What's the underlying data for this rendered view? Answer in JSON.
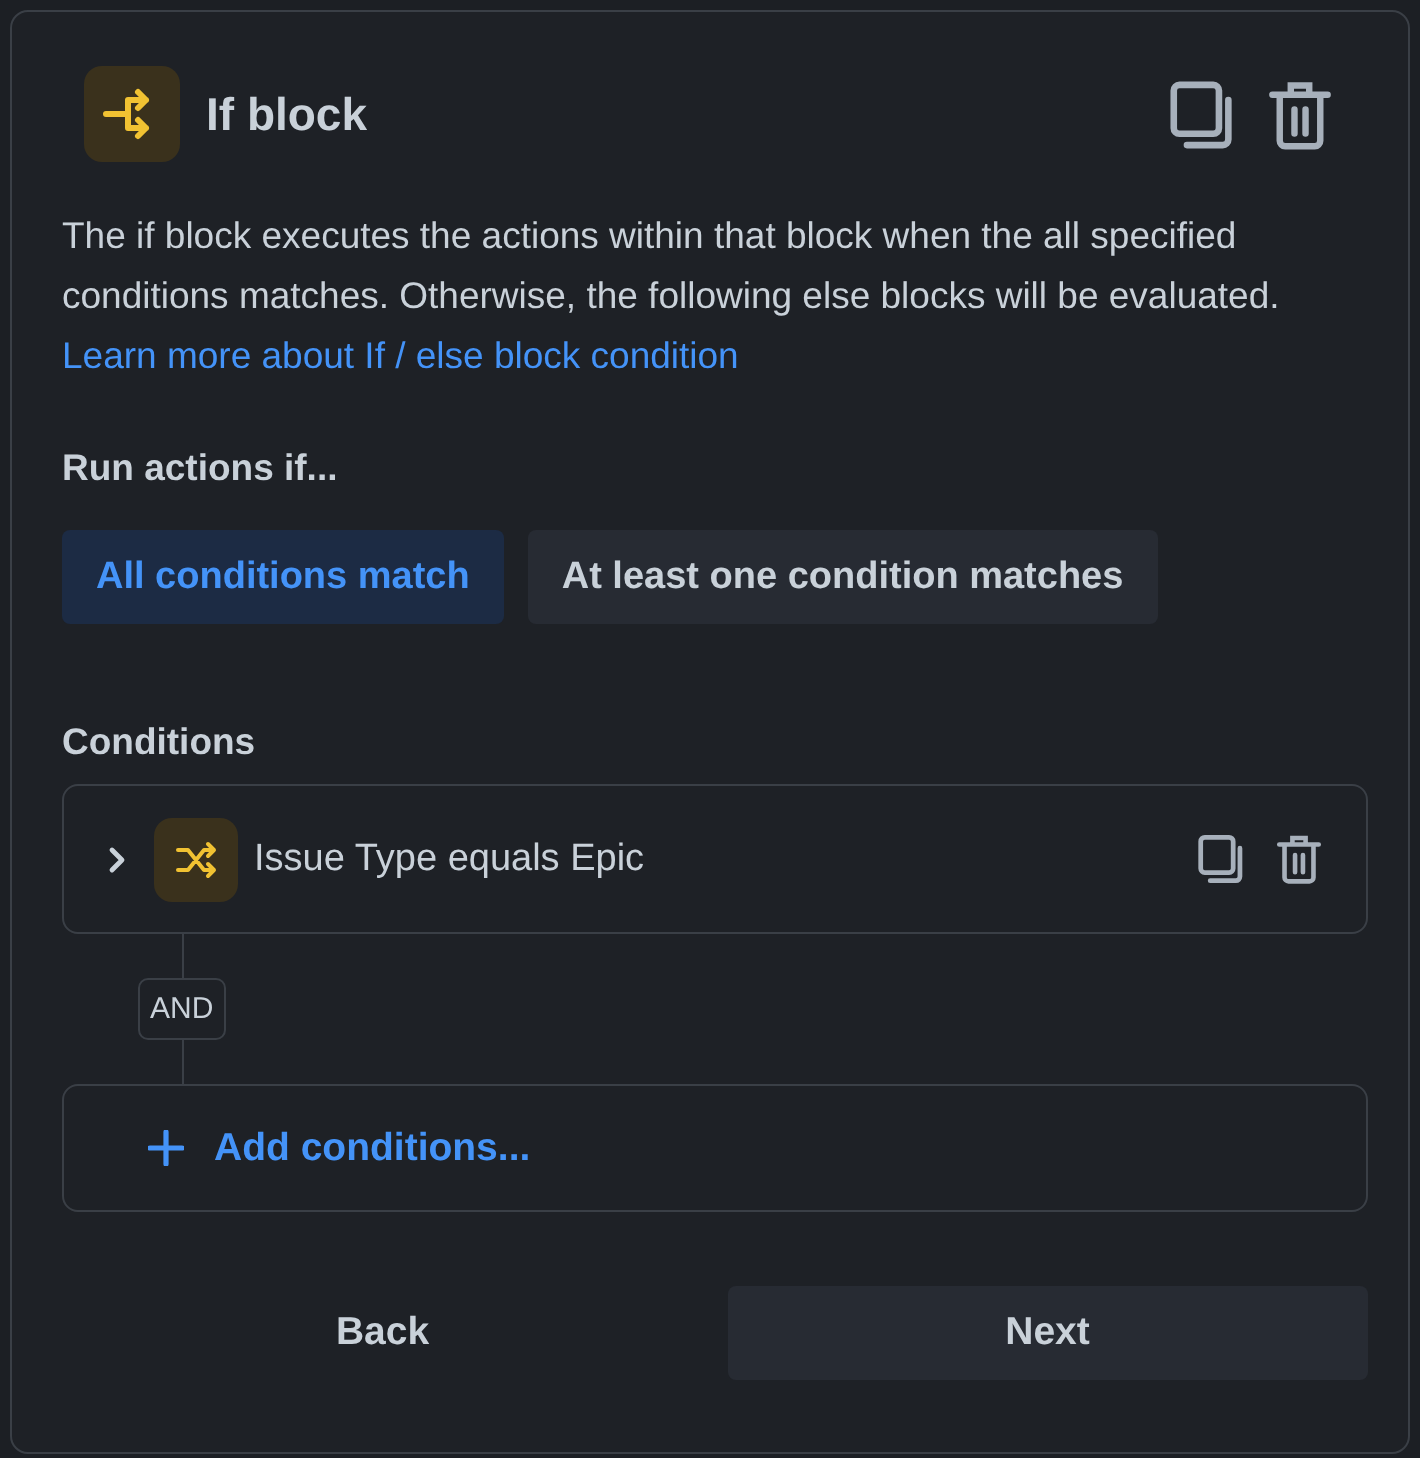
{
  "header": {
    "title": "If block"
  },
  "description": {
    "text": "The if block executes the actions within that block when the all specified conditions matches. Otherwise, the following else blocks will be evaluated.",
    "link": "Learn more about If / else block condition"
  },
  "run_actions": {
    "label": "Run actions if...",
    "options": [
      {
        "label": "All conditions match",
        "selected": true
      },
      {
        "label": "At least one condition matches",
        "selected": false
      }
    ]
  },
  "conditions": {
    "label": "Conditions",
    "items": [
      {
        "text": "Issue Type equals Epic",
        "expanded": false
      }
    ],
    "connector": "AND",
    "add_label": "Add conditions..."
  },
  "footer": {
    "buttons": [
      {
        "label": "Back",
        "kind": "secondary"
      },
      {
        "label": "Next",
        "kind": "primary"
      }
    ]
  }
}
